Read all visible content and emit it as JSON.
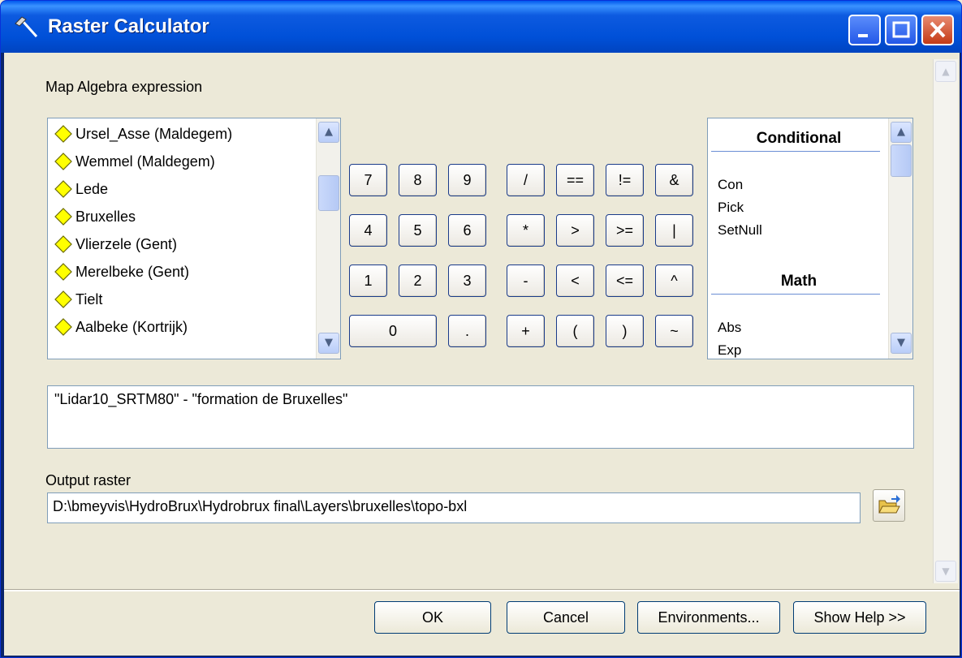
{
  "window": {
    "title": "Raster Calculator",
    "title_icon": "hammer-icon",
    "controls": [
      "minimize-icon",
      "maximize-icon",
      "close-icon"
    ]
  },
  "expression_section": {
    "label": "Map Algebra expression"
  },
  "layers": [
    "Ursel_Asse (Maldegem)",
    "Wemmel (Maldegem)",
    "Lede",
    "Bruxelles",
    "Vlierzele (Gent)",
    "Merelbeke (Gent)",
    "Tielt",
    "Aalbeke (Kortrijk)"
  ],
  "keypad": {
    "numbers": [
      "7",
      "8",
      "9",
      "4",
      "5",
      "6",
      "1",
      "2",
      "3",
      "0",
      "."
    ],
    "operators": [
      "/",
      "==",
      "!=",
      "&",
      "*",
      ">",
      ">=",
      "|",
      "-",
      "<",
      "<=",
      "^",
      "+",
      "(",
      ")",
      "~"
    ]
  },
  "functions": {
    "groups": [
      {
        "header": "Conditional",
        "items": [
          "Con",
          "Pick",
          "SetNull"
        ]
      },
      {
        "header": "Math",
        "items": [
          "Abs",
          "Exp"
        ]
      }
    ]
  },
  "expression_text": "\"Lidar10_SRTM80\" - \"formation de Bruxelles\"",
  "output": {
    "label": "Output raster",
    "value": "D:\\bmeyvis\\HydroBrux\\Hydrobrux final\\Layers\\bruxelles\\topo-bxl",
    "browse_icon": "open-folder-icon"
  },
  "buttons": {
    "ok": "OK",
    "cancel": "Cancel",
    "environments": "Environments...",
    "help": "Show Help >>"
  }
}
